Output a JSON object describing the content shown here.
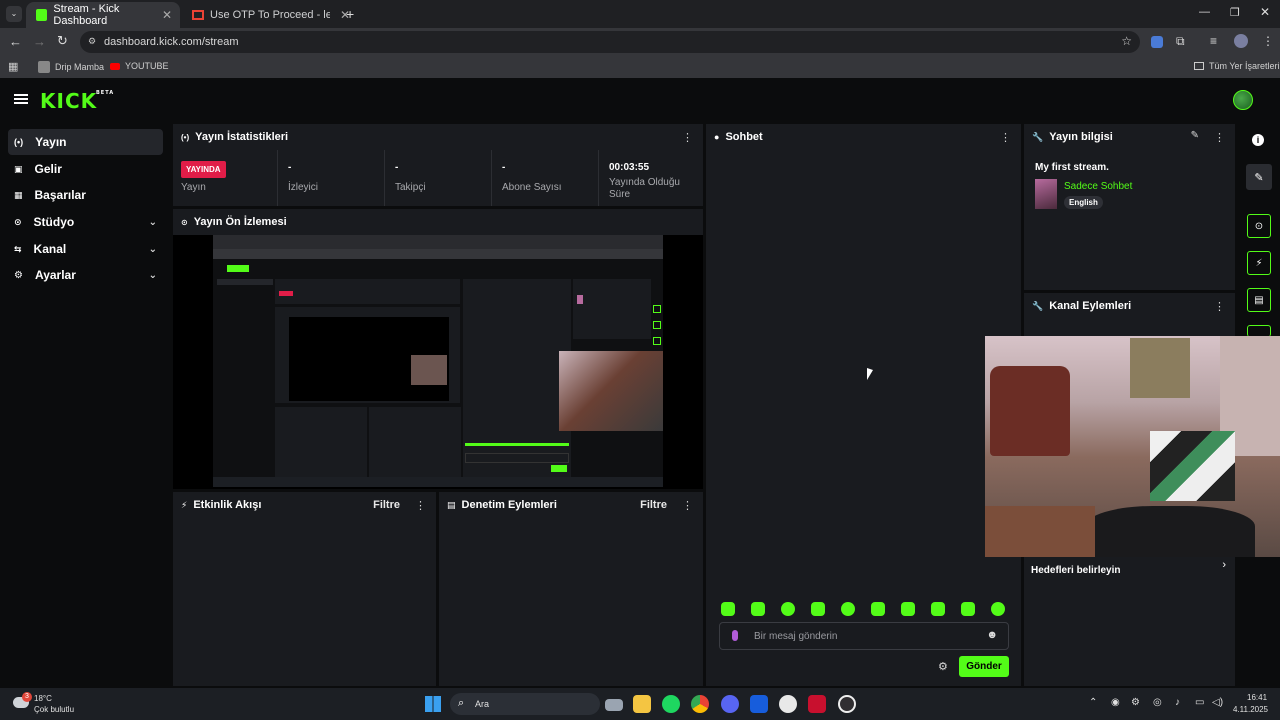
{
  "browser": {
    "tabs": [
      {
        "label": "Stream - Kick Dashboard",
        "active": true
      },
      {
        "label": "Use OTP To Proceed - leonzoffic...",
        "active": false
      }
    ],
    "url": "dashboard.kick.com/stream",
    "bookmarks": [
      {
        "label": "Drip Mamba"
      },
      {
        "label": "YOUTUBE"
      }
    ],
    "all_bookmarks": "Tüm Yer İşaretleri"
  },
  "app": {
    "logo": "KICK",
    "logo_badge": "BETA",
    "accent": "#53fc18",
    "sidebar": [
      {
        "label": "Yayın",
        "active": true,
        "expandable": false
      },
      {
        "label": "Gelir",
        "active": false,
        "expandable": false
      },
      {
        "label": "Başarılar",
        "active": false,
        "expandable": false
      },
      {
        "label": "Stüdyo",
        "active": false,
        "expandable": true
      },
      {
        "label": "Kanal",
        "active": false,
        "expandable": true
      },
      {
        "label": "Ayarlar",
        "active": false,
        "expandable": true
      }
    ],
    "stats_panel": {
      "title": "Yayın İstatistikleri",
      "live_badge": "YAYINDA",
      "live_label": "Yayın",
      "items": [
        {
          "value": "-",
          "label": "İzleyici"
        },
        {
          "value": "-",
          "label": "Takipçi"
        },
        {
          "value": "-",
          "label": "Abone Sayısı"
        },
        {
          "value": "00:03:55",
          "label": "Yayında Olduğu Süre"
        }
      ]
    },
    "preview_panel": {
      "title": "Yayın Ön İzlemesi"
    },
    "activity_panel": {
      "title": "Etkinlik Akışı",
      "filter": "Filtre"
    },
    "moderation_panel": {
      "title": "Denetim Eylemleri",
      "filter": "Filtre"
    },
    "chat_panel": {
      "title": "Sohbet",
      "placeholder": "Bir mesaj gönderin",
      "send": "Gönder"
    },
    "stream_info": {
      "title": "Yayın bilgisi",
      "stream_title": "My first stream.",
      "category": "Sadece Sohbet",
      "language": "English"
    },
    "channel_actions": {
      "title": "Kanal Eylemleri"
    },
    "goals": {
      "label": "Hedefleri belirleyin"
    }
  },
  "taskbar": {
    "weather_temp": "18°C",
    "weather_desc": "Çok bulutlu",
    "weather_badge": "3",
    "search": "Ara",
    "time": "16:41",
    "date": "4.11.2025"
  }
}
